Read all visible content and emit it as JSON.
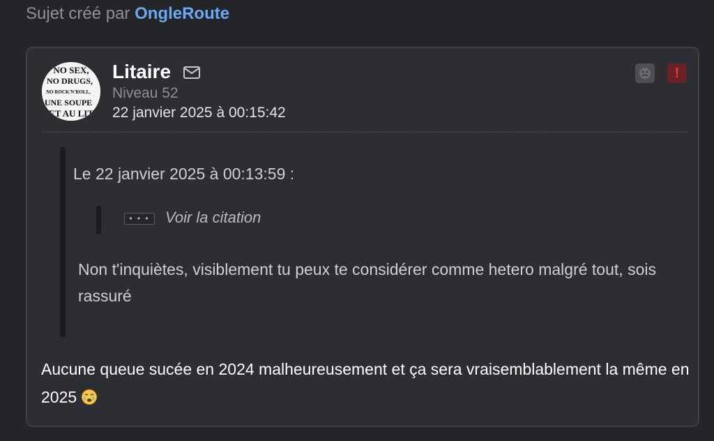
{
  "topic": {
    "prefix": "Sujet créé par",
    "author": "OngleRoute"
  },
  "post": {
    "username": "Litaire",
    "level": "Niveau 52",
    "date": "22 janvier 2025 à 00:15:42",
    "avatar_text": [
      "NO SEX,",
      "NO DRUGS,",
      "NO ROCK'N'ROLL,",
      "UNE SOUPE",
      "ET AU LIT"
    ],
    "icons": [
      "mail-icon",
      "sad-face-icon",
      "alert-icon"
    ],
    "quote": {
      "header": "Le 22 janvier 2025 à 00:13:59 :",
      "toggle_label": "• • •",
      "voir_citation": "Voir la citation",
      "text": "Non t'inquiètes, visiblement tu peux te considérer comme hetero malgré tout, sois rassuré"
    },
    "body": "Aucune queue sucée en 2024 malheureusement et ça sera vraisemblablement la même en 2025",
    "emoji": "crying-face-emoji"
  },
  "colors": {
    "background": "#242529",
    "card": "#2d2e33",
    "link": "#6aa8f0",
    "alert": "#e23d3d"
  }
}
